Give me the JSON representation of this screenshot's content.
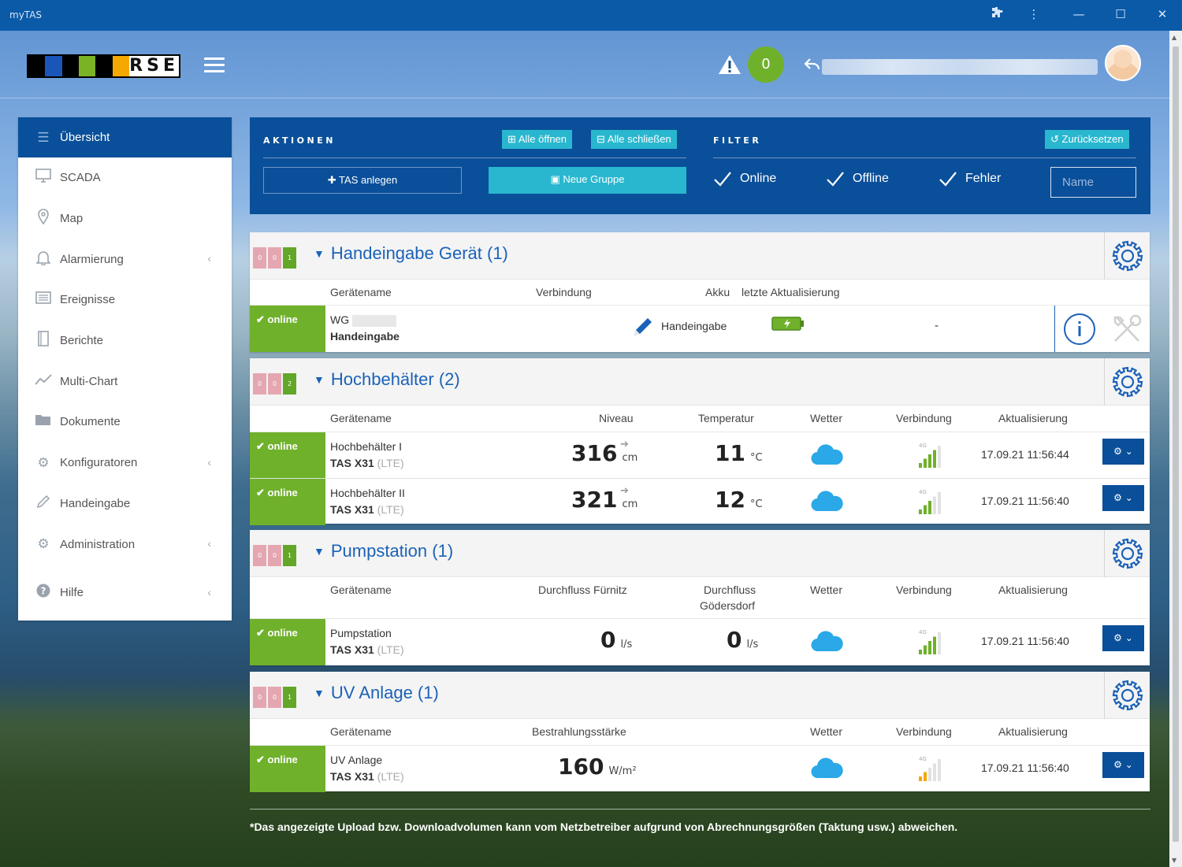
{
  "window": {
    "title": "myTAS"
  },
  "header": {
    "logo_text": "RSE",
    "alarm_count": "0"
  },
  "sidebar": {
    "items": [
      {
        "label": "Übersicht",
        "icon": "list-icon"
      },
      {
        "label": "SCADA",
        "icon": "monitor-icon"
      },
      {
        "label": "Map",
        "icon": "map-pin-icon"
      },
      {
        "label": "Alarmierung",
        "icon": "bell-icon"
      },
      {
        "label": "Ereignisse",
        "icon": "events-icon"
      },
      {
        "label": "Berichte",
        "icon": "report-icon"
      },
      {
        "label": "Multi-Chart",
        "icon": "line-chart-icon"
      },
      {
        "label": "Dokumente",
        "icon": "folder-icon"
      },
      {
        "label": "Konfiguratoren",
        "icon": "cogs-icon"
      },
      {
        "label": "Handeingabe",
        "icon": "pencil-icon"
      },
      {
        "label": "Administration",
        "icon": "gear-icon"
      },
      {
        "label": "Hilfe",
        "icon": "help-icon"
      }
    ]
  },
  "actions": {
    "title": "AKTIONEN",
    "open_all": "Alle öffnen",
    "close_all": "Alle schließen",
    "create_tas": "TAS anlegen",
    "new_group": "Neue Gruppe"
  },
  "filter": {
    "title": "FILTER",
    "reset": "Zurücksetzen",
    "online": "Online",
    "offline": "Offline",
    "error": "Fehler",
    "name_placeholder": "Name"
  },
  "groups": [
    {
      "title": "Handeingabe Gerät (1)",
      "counts": [
        "0",
        "0",
        "1"
      ],
      "columns": {
        "name": "Gerätename",
        "conn": "Verbindung",
        "battery": "Akku",
        "update": "letzte Aktualisierung"
      },
      "devices": [
        {
          "status": "online",
          "name": "WG",
          "type": "Handeingabe",
          "connection": "Handeingabe",
          "update": "-"
        }
      ]
    },
    {
      "title": "Hochbehälter (2)",
      "counts": [
        "0",
        "0",
        "2"
      ],
      "columns": {
        "name": "Gerätename",
        "v1": "Niveau",
        "v2": "Temperatur",
        "weather": "Wetter",
        "conn": "Verbindung",
        "update": "Aktualisierung"
      },
      "devices": [
        {
          "status": "online",
          "name": "Hochbehälter I",
          "model": "TAS X31",
          "net": "(LTE)",
          "v1": "316",
          "u1": "cm",
          "v2": "11",
          "u2": "°C",
          "update": "17.09.21 11:56:44",
          "signal": 4
        },
        {
          "status": "online",
          "name": "Hochbehälter II",
          "model": "TAS X31",
          "net": "(LTE)",
          "v1": "321",
          "u1": "cm",
          "v2": "12",
          "u2": "°C",
          "update": "17.09.21 11:56:40",
          "signal": 3
        }
      ]
    },
    {
      "title": "Pumpstation (1)",
      "counts": [
        "0",
        "0",
        "1"
      ],
      "columns": {
        "name": "Gerätename",
        "v1": "Durchfluss Fürnitz",
        "v2a": "Durchfluss",
        "v2b": "Gödersdorf",
        "weather": "Wetter",
        "conn": "Verbindung",
        "update": "Aktualisierung"
      },
      "devices": [
        {
          "status": "online",
          "name": "Pumpstation",
          "model": "TAS X31",
          "net": "(LTE)",
          "v1": "0",
          "u1": "l/s",
          "v2": "0",
          "u2": "l/s",
          "update": "17.09.21 11:56:40",
          "signal": 4
        }
      ]
    },
    {
      "title": "UV Anlage (1)",
      "counts": [
        "0",
        "0",
        "1"
      ],
      "columns": {
        "name": "Gerätename",
        "v1": "Bestrahlungsstärke",
        "weather": "Wetter",
        "conn": "Verbindung",
        "update": "Aktualisierung"
      },
      "devices": [
        {
          "status": "online",
          "name": "UV Anlage",
          "model": "TAS X31",
          "net": "(LTE)",
          "v1": "160",
          "u1": "W/m²",
          "update": "17.09.21 11:56:40",
          "signal": 2
        }
      ]
    }
  ],
  "footnote": "*Das angezeigte Upload bzw. Downloadvolumen kann vom Netzbetreiber aufgrund von Abrechnungsgrößen (Taktung usw.) abweichen.",
  "colors": {
    "primary": "#0a4f99",
    "accent": "#29b7cf",
    "online": "#6fb12b",
    "title_blue": "#1b62b8"
  }
}
